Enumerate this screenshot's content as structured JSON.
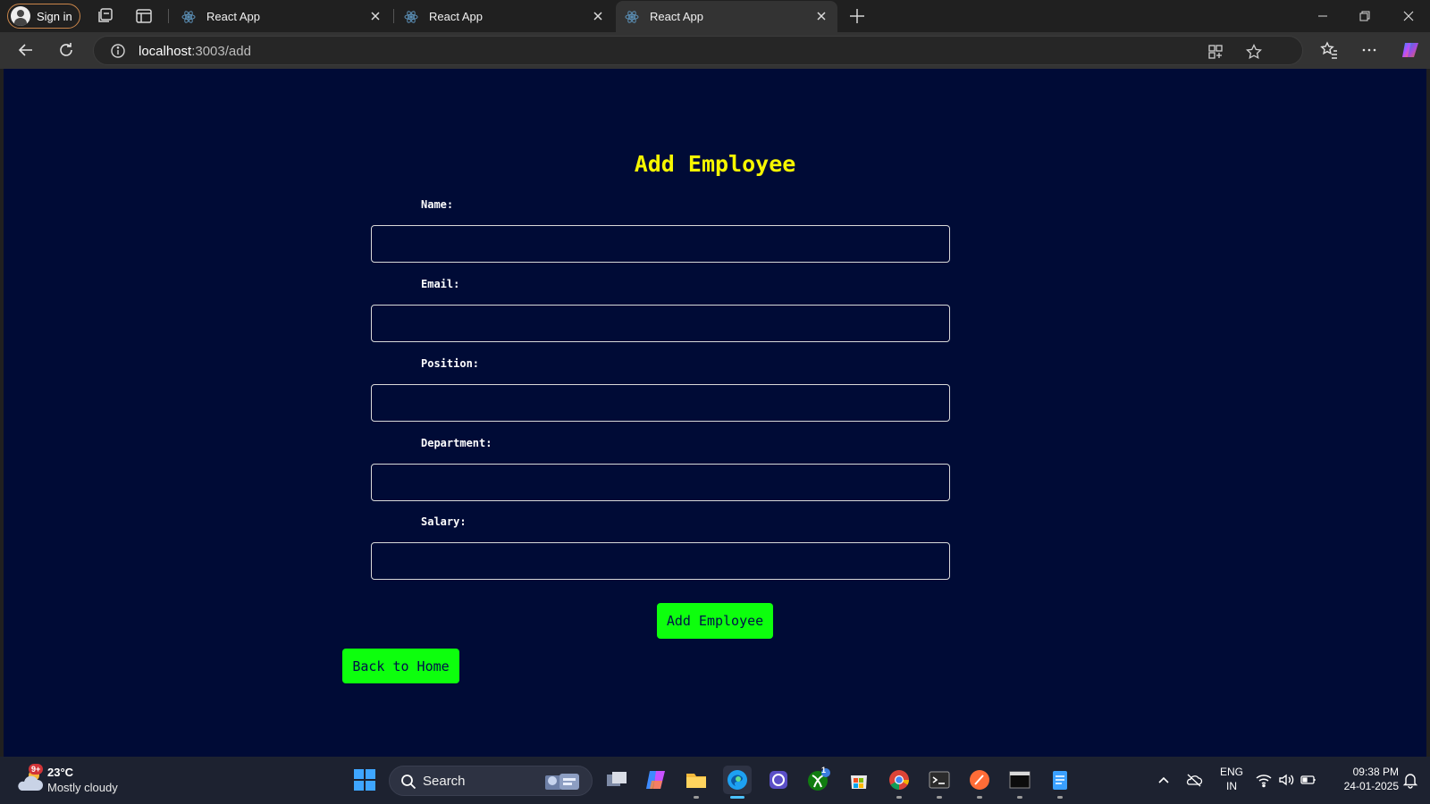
{
  "browser": {
    "signin_label": "Sign in",
    "tabs": [
      {
        "title": "React App",
        "active": false
      },
      {
        "title": "React App",
        "active": false
      },
      {
        "title": "React App",
        "active": true
      }
    ],
    "url": {
      "host": "localhost",
      "rest": ":3003/add"
    }
  },
  "page": {
    "title": "Add Employee",
    "fields": [
      {
        "label": "Name:",
        "value": ""
      },
      {
        "label": "Email:",
        "value": ""
      },
      {
        "label": "Position:",
        "value": ""
      },
      {
        "label": "Department:",
        "value": ""
      },
      {
        "label": "Salary:",
        "value": ""
      }
    ],
    "submit_label": "Add Employee",
    "back_label": "Back to Home",
    "colors": {
      "background": "#000b36",
      "title": "#f6f600",
      "button": "#0dff0d"
    }
  },
  "taskbar": {
    "weather": {
      "badge": "9+",
      "temp": "23°C",
      "condition": "Mostly cloudy"
    },
    "search_label": "Search",
    "xbox_badge": "1",
    "lang": {
      "line1": "ENG",
      "line2": "IN"
    },
    "clock": {
      "time": "09:38 PM",
      "date": "24-01-2025"
    }
  }
}
